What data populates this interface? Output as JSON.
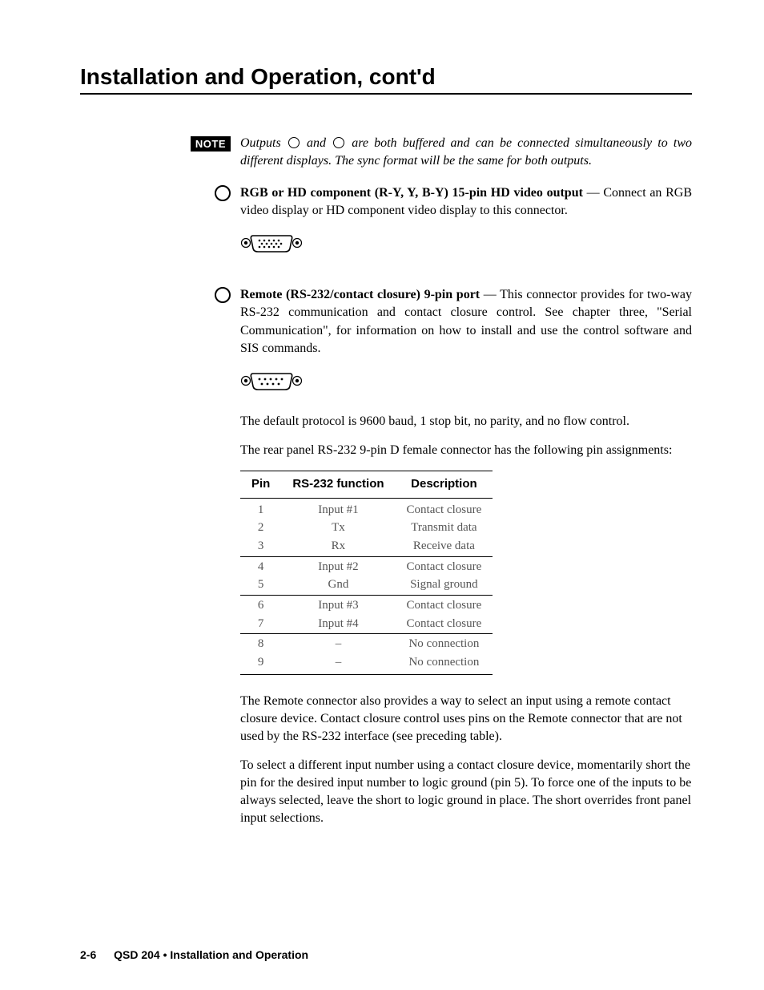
{
  "heading": "Installation and Operation, cont'd",
  "note": {
    "label": "NOTE",
    "pre": "Outputs ",
    "mid": " and ",
    "post": " are both buffered and can be connected simultaneously to two different displays.  The sync format will be the same for both outputs."
  },
  "section1": {
    "title": "RGB or HD component (R-Y, Y, B-Y) 15-pin HD video output",
    "dash": " — ",
    "body": "Connect an RGB video display or HD component video display to this connector."
  },
  "section2": {
    "title": "Remote (RS-232/contact closure) 9-pin port",
    "dash": " — ",
    "body": "This connector provides for two-way RS-232 communication and contact closure control.  See chapter three, \"Serial Communication\", for information on how to install and use the control software and SIS commands."
  },
  "para_default": "The default protocol is 9600 baud, 1 stop bit, no parity, and no flow control.",
  "para_pinassign": "The rear panel RS-232 9-pin D female connector has the following pin assignments:",
  "table": {
    "headers": [
      "Pin",
      "RS-232 function",
      "Description"
    ],
    "groups": [
      [
        {
          "pin": "1",
          "func": "Input #1",
          "desc": "Contact closure"
        },
        {
          "pin": "2",
          "func": "Tx",
          "desc": "Transmit data"
        },
        {
          "pin": "3",
          "func": "Rx",
          "desc": "Receive data"
        }
      ],
      [
        {
          "pin": "4",
          "func": "Input #2",
          "desc": "Contact closure"
        },
        {
          "pin": "5",
          "func": "Gnd",
          "desc": "Signal ground"
        }
      ],
      [
        {
          "pin": "6",
          "func": "Input #3",
          "desc": "Contact closure"
        },
        {
          "pin": "7",
          "func": "Input #4",
          "desc": "Contact closure"
        }
      ],
      [
        {
          "pin": "8",
          "func": "–",
          "desc": "No connection"
        },
        {
          "pin": "9",
          "func": "–",
          "desc": "No connection"
        }
      ]
    ]
  },
  "para_remote": "The Remote connector also provides a way to select an input using a remote contact closure device.  Contact closure control uses pins on the Remote connector that are not used by the RS-232 interface (see preceding table).",
  "para_select": "To select a different input number using a contact closure device, momentarily short the pin for the desired input number to logic ground (pin 5). To force one of the inputs to be always selected, leave the short to logic ground in place.  The short overrides front panel input selections.",
  "footer": {
    "page": "2-6",
    "title": "QSD 204 • Installation and Operation"
  }
}
